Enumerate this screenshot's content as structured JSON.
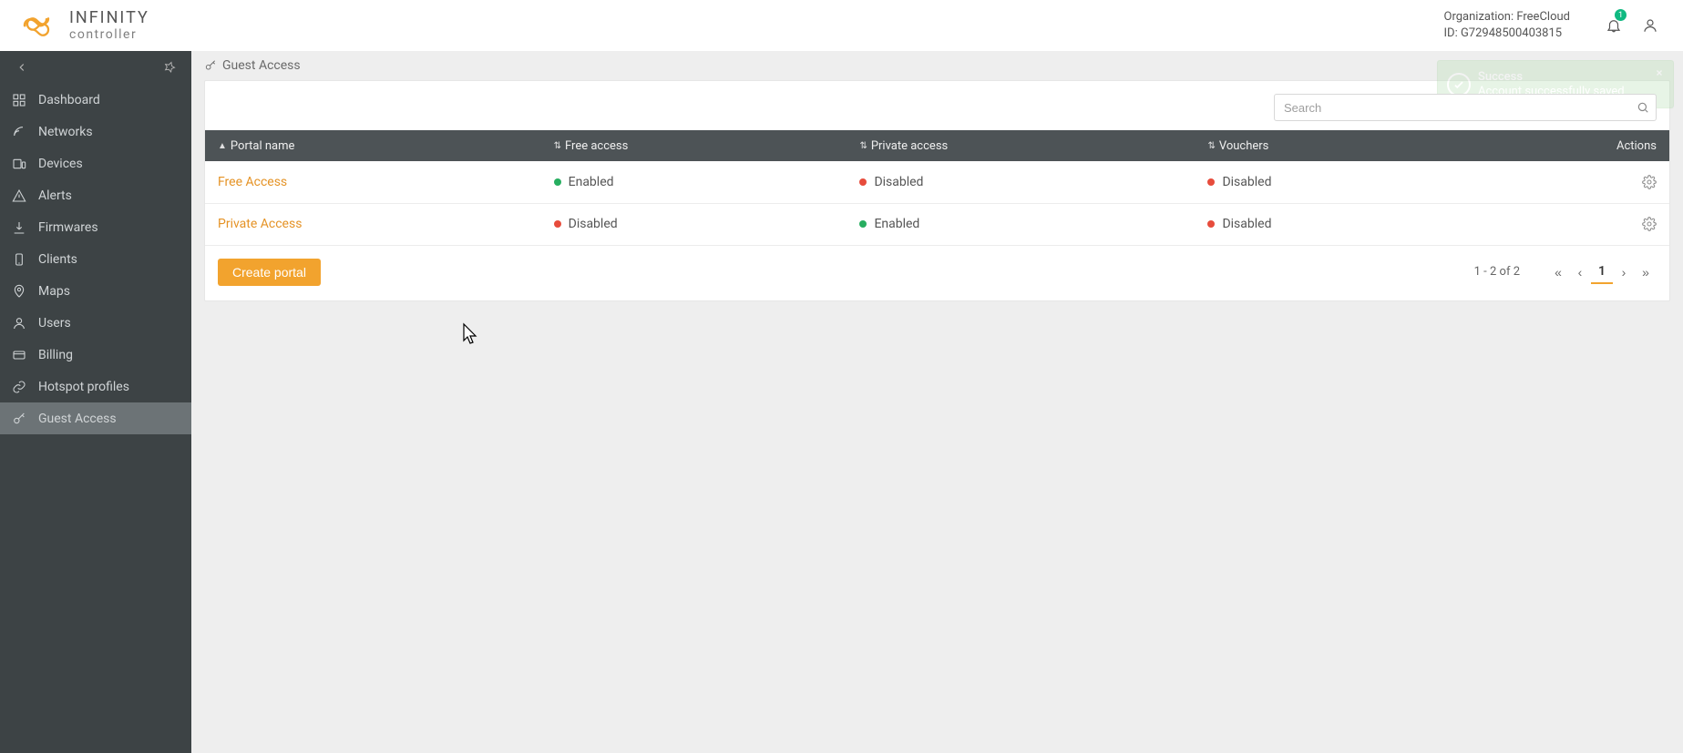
{
  "brand": {
    "name": "INFINITY",
    "sub": "controller"
  },
  "header": {
    "org_label": "Organization:",
    "org_name": "FreeCloud",
    "id_label": "ID:",
    "id_value": "G72948500403815",
    "notification_count": "1"
  },
  "sidebar": {
    "items": [
      {
        "label": "Dashboard",
        "icon": "dashboard"
      },
      {
        "label": "Networks",
        "icon": "signal"
      },
      {
        "label": "Devices",
        "icon": "devices"
      },
      {
        "label": "Alerts",
        "icon": "alert"
      },
      {
        "label": "Firmwares",
        "icon": "download"
      },
      {
        "label": "Clients",
        "icon": "client"
      },
      {
        "label": "Maps",
        "icon": "map"
      },
      {
        "label": "Users",
        "icon": "user"
      },
      {
        "label": "Billing",
        "icon": "billing"
      },
      {
        "label": "Hotspot profiles",
        "icon": "link"
      },
      {
        "label": "Guest Access",
        "icon": "key",
        "active": true
      }
    ]
  },
  "page": {
    "title": "Guest Access"
  },
  "search": {
    "placeholder": "Search",
    "value": ""
  },
  "table": {
    "columns": {
      "portal_name": "Portal name",
      "free_access": "Free access",
      "private_access": "Private access",
      "vouchers": "Vouchers",
      "actions": "Actions"
    },
    "rows": [
      {
        "portal_name": "Free Access",
        "free_access": {
          "label": "Enabled",
          "state": "green"
        },
        "private_access": {
          "label": "Disabled",
          "state": "red"
        },
        "vouchers": {
          "label": "Disabled",
          "state": "red"
        }
      },
      {
        "portal_name": "Private Access",
        "free_access": {
          "label": "Disabled",
          "state": "red"
        },
        "private_access": {
          "label": "Enabled",
          "state": "green"
        },
        "vouchers": {
          "label": "Disabled",
          "state": "red"
        }
      }
    ]
  },
  "buttons": {
    "create_portal": "Create portal"
  },
  "pagination": {
    "range": "1 - 2 of 2",
    "current": "1"
  },
  "toast": {
    "title": "Success",
    "message": "Account successfully saved"
  }
}
